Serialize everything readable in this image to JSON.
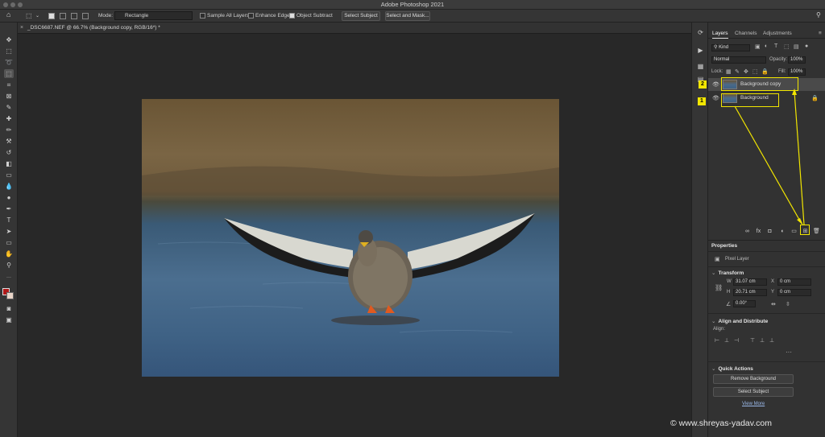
{
  "app": {
    "title": "Adobe Photoshop 2021"
  },
  "options_bar": {
    "mode_label": "Mode:",
    "mode_value": "Rectangle",
    "sample_all_layers": {
      "label": "Sample All Layers",
      "checked": false
    },
    "enhance_edge": {
      "label": "Enhance Edge",
      "checked": false
    },
    "object_subtract": {
      "label": "Object Subtract",
      "checked": true
    },
    "select_subject_label": "Select Subject",
    "select_and_mask_label": "Select and Mask..."
  },
  "document": {
    "tab_title": "_DSC6687.NEF @ 66.7% (Background copy, RGB/16*) *"
  },
  "colors": {
    "foreground": "#b01818",
    "background": "#e8d4c8",
    "annotation": "#f2e600",
    "link": "#9ab8e8"
  },
  "layers_panel": {
    "tabs": [
      "Layers",
      "Channels",
      "Adjustments"
    ],
    "active_tab": "Layers",
    "filter_value": "Kind",
    "blend_mode": "Normal",
    "opacity_label": "Opacity:",
    "opacity_value": "100%",
    "lock_label": "Lock:",
    "fill_label": "Fill:",
    "fill_value": "100%",
    "layers": [
      {
        "name": "Background copy",
        "badge": "2",
        "selected": true
      },
      {
        "name": "Background",
        "badge": "1",
        "locked": true
      }
    ]
  },
  "properties_panel": {
    "title": "Properties",
    "layer_type": "Pixel Layer",
    "transform": {
      "title": "Transform",
      "w_label": "W",
      "w_value": "31.07 cm",
      "h_label": "H",
      "h_value": "20.71 cm",
      "x_label": "X",
      "x_value": "0 cm",
      "y_label": "Y",
      "y_value": "0 cm",
      "angle_value": "0.00°"
    },
    "align": {
      "title": "Align and Distribute",
      "align_label": "Align:"
    },
    "quick_actions": {
      "title": "Quick Actions",
      "remove_bg_label": "Remove Background",
      "select_subject_label": "Select Subject",
      "view_more_label": "View More"
    }
  },
  "watermark": "© www.shreyas-yadav.com"
}
